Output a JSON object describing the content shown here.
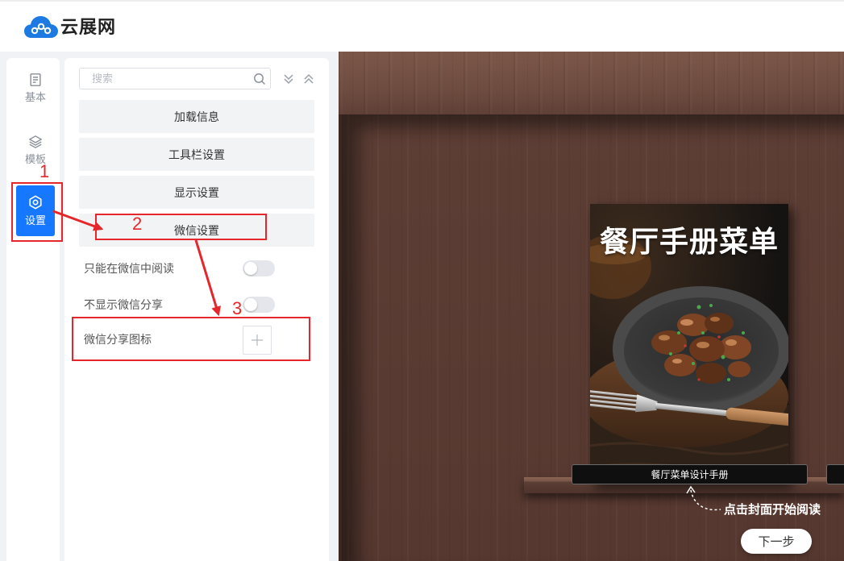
{
  "header": {
    "brand": "云展网",
    "logo_icon": "cloud-logo-icon"
  },
  "nav": {
    "items": [
      {
        "label": "基本",
        "icon": "document-icon",
        "active": false
      },
      {
        "label": "模板",
        "icon": "layers-icon",
        "active": false
      },
      {
        "label": "设置",
        "icon": "settings-icon",
        "active": true
      }
    ]
  },
  "panel": {
    "search": {
      "placeholder": "搜索",
      "value": ""
    },
    "sections": [
      {
        "label": "加载信息"
      },
      {
        "label": "工具栏设置"
      },
      {
        "label": "显示设置"
      },
      {
        "label": "微信设置"
      }
    ],
    "settings": [
      {
        "label": "只能在微信中阅读",
        "type": "toggle",
        "value": false
      },
      {
        "label": "不显示微信分享",
        "type": "toggle",
        "value": false
      },
      {
        "label": "微信分享图标",
        "type": "upload",
        "value": ""
      }
    ]
  },
  "annotations": [
    {
      "label": "1"
    },
    {
      "label": "2"
    },
    {
      "label": "3"
    }
  ],
  "preview": {
    "book": {
      "cover_title": "餐厅手册菜单",
      "caption": "餐厅菜单设计手册"
    },
    "hint": "点击封面开始阅读",
    "next_label": "下一步"
  },
  "colors": {
    "accent": "#1677ff",
    "annotation": "#e5262b",
    "wood": "#5a3b32"
  }
}
